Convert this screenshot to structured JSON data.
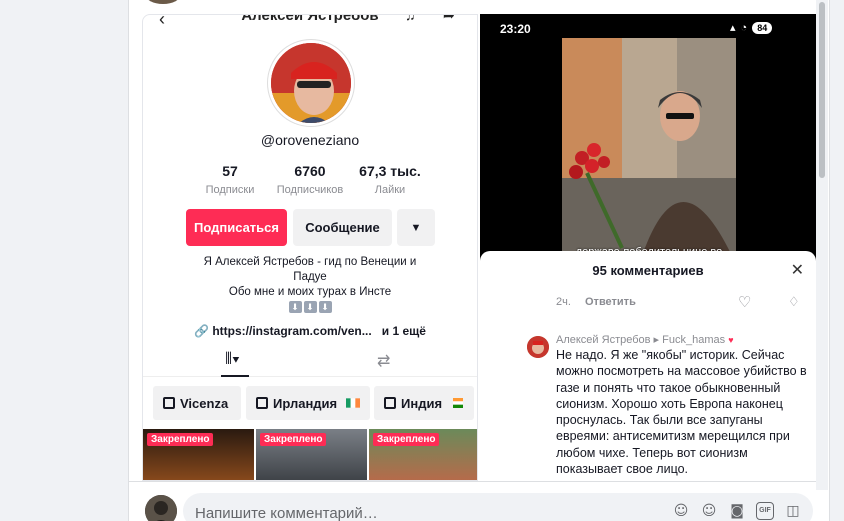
{
  "tiktok_profile": {
    "header_name": "Алексей Ястребов",
    "handle": "@oroveneziano",
    "stats": [
      {
        "value": "57",
        "label": "Подписки"
      },
      {
        "value": "6760",
        "label": "Подписчиков"
      },
      {
        "value": "67,3 тыс.",
        "label": "Лайки"
      }
    ],
    "follow_label": "Подписаться",
    "message_label": "Сообщение",
    "more_label": "▼",
    "bio_lines": [
      "Я Алексей Ястребов - гид по Венеции и",
      "Падуе",
      "Обо мне и моих турах в Инсте"
    ],
    "link_text": "https://instagram.com/ven...",
    "link_more": "и 1 ещё",
    "playlists": [
      "Vicenza",
      "Ирландия",
      "Индия"
    ],
    "pinned_label": "Закреплено"
  },
  "tiktok_comments": {
    "time": "23:20",
    "battery": "84",
    "video_caption": "державе-победительнице во",
    "title": "95 комментариев",
    "first_comment_age": "2ч.",
    "reply_label": "Ответить",
    "author": "Алексей Ястребов",
    "reply_to": "Fuck_hamas",
    "comment_text": "Не надо. Я же \"якобы\" историк. Сейчас можно посмотреть на массовое убийство в газе и понять что такое обыкновенный сионизм. Хорошо хоть Европа наконец проснулась. Так были все запуганы евреями: антисемитизм мерещился при любом чихе. Теперь вот сионизм показывает свое лицо."
  },
  "composer": {
    "placeholder": "Напишите комментарий…",
    "icons": [
      "avatar-sticker-icon",
      "emoji-icon",
      "camera-icon",
      "gif-icon",
      "sticker-icon"
    ],
    "gif_label": "GIF"
  }
}
